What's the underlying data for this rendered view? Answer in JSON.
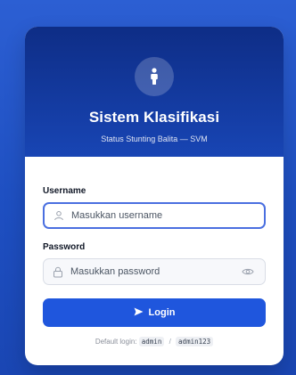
{
  "header": {
    "title": "Sistem Klasifikasi",
    "subtitle": "Status Stunting Balita — SVM",
    "icon": "info-person-icon"
  },
  "form": {
    "username_label": "Username",
    "username_placeholder": "Masukkan username",
    "username_value": "",
    "password_label": "Password",
    "password_placeholder": "Masukkan password",
    "password_value": "",
    "login_label": "Login"
  },
  "hint": {
    "prefix": "Default login:",
    "user": "admin",
    "separator": "/",
    "pass": "admin123"
  },
  "colors": {
    "header_dark": "#0e2d86",
    "button": "#1f56dd",
    "focus_border": "#4a6fe0"
  }
}
